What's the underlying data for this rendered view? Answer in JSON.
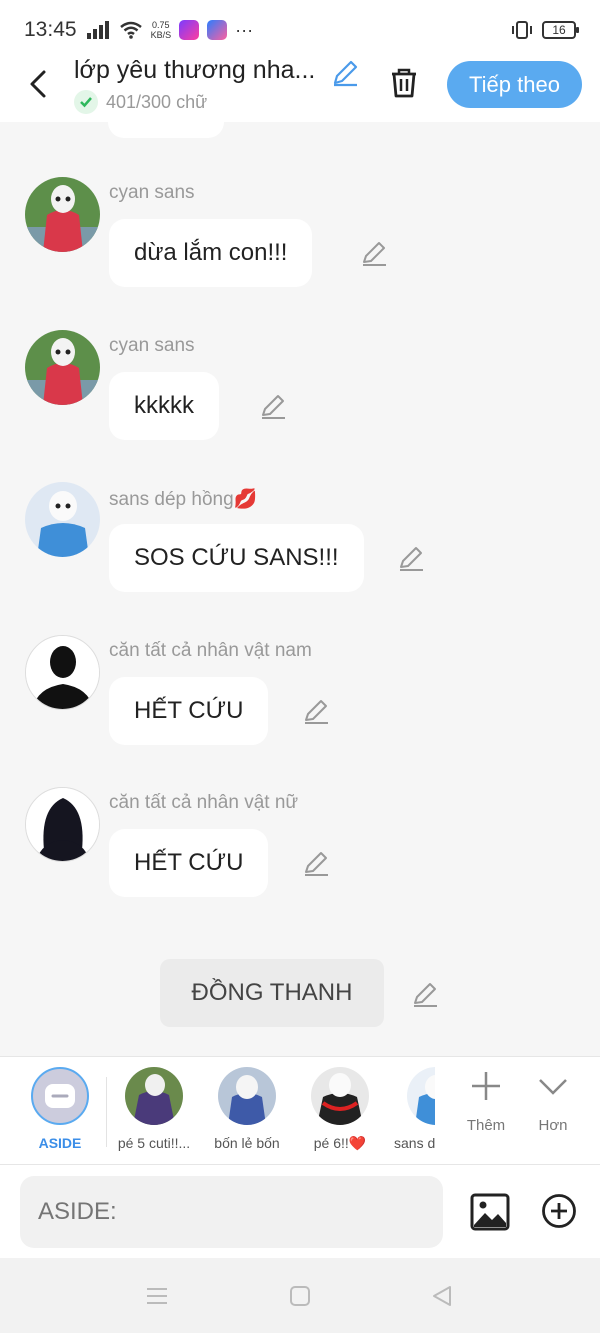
{
  "status_bar": {
    "time": "13:45",
    "speed": "0.75",
    "speed_unit": "KB/S",
    "more": "···",
    "battery": "16"
  },
  "header": {
    "title": "lớp yêu thương nha...",
    "word_count": "401/300 chữ",
    "next_label": "Tiếp theo",
    "accent": "#5aaaf0"
  },
  "messages": [
    {
      "sender": "cyan sans",
      "text": "dừa lắm con!!!"
    },
    {
      "sender": "cyan sans",
      "text": "kkkkk"
    },
    {
      "sender": "sans dép hồng",
      "sender_emoji": "💋",
      "text": "SOS CỨU SANS!!!"
    },
    {
      "sender": "căn tất cả nhân vật nam",
      "text": "HẾT CỨU"
    },
    {
      "sender": "căn tất cả nhân vật nữ",
      "text": "HẾT CỨU"
    }
  ],
  "system_message": "ĐỒNG THANH",
  "characters": [
    {
      "label": "ASIDE",
      "selected": true
    },
    {
      "label": "pé 5 cuti!!..."
    },
    {
      "label": "bốn lẻ bốn"
    },
    {
      "label": "pé 6!!❤️"
    },
    {
      "label": "sans d"
    }
  ],
  "more_label": "Thêm",
  "expand_label": "Hơn",
  "input": {
    "placeholder": "ASIDE:"
  },
  "icons": [
    "back-arrow-icon",
    "pencil-icon",
    "trash-icon",
    "check-icon",
    "image-icon",
    "plus-circle-icon",
    "menu-icon",
    "home-icon",
    "back-triangle-icon"
  ]
}
